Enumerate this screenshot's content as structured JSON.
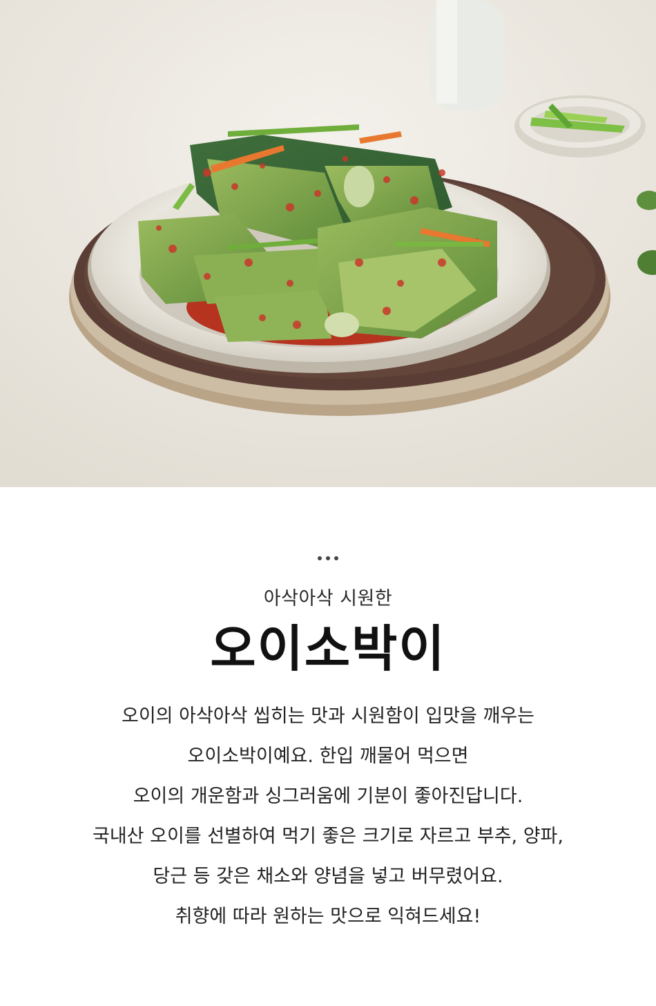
{
  "hero": {
    "image": "oi-sobagi-plate-photo",
    "colors": {
      "background": "#ece8e1",
      "cucumber": "#6f9a45",
      "chili": "#c8382a",
      "bowl": "#e8e5dd",
      "tray": "#5a3e35"
    }
  },
  "section": {
    "dots_icon": "ellipsis-icon",
    "subtitle": "아삭아삭 시원한",
    "title": "오이소박이",
    "description_lines": [
      "오이의 아삭아삭 씹히는 맛과 시원함이 입맛을 깨우는",
      "오이소박이예요. 한입 깨물어 먹으면",
      "오이의 개운함과 싱그러움에 기분이 좋아진답니다.",
      "국내산 오이를 선별하여 먹기 좋은 크기로 자르고 부추, 양파,",
      "당근 등 갖은 채소와 양념을 넣고 버무렸어요.",
      "취향에 따라 원하는 맛으로 익혀드세요!"
    ]
  }
}
